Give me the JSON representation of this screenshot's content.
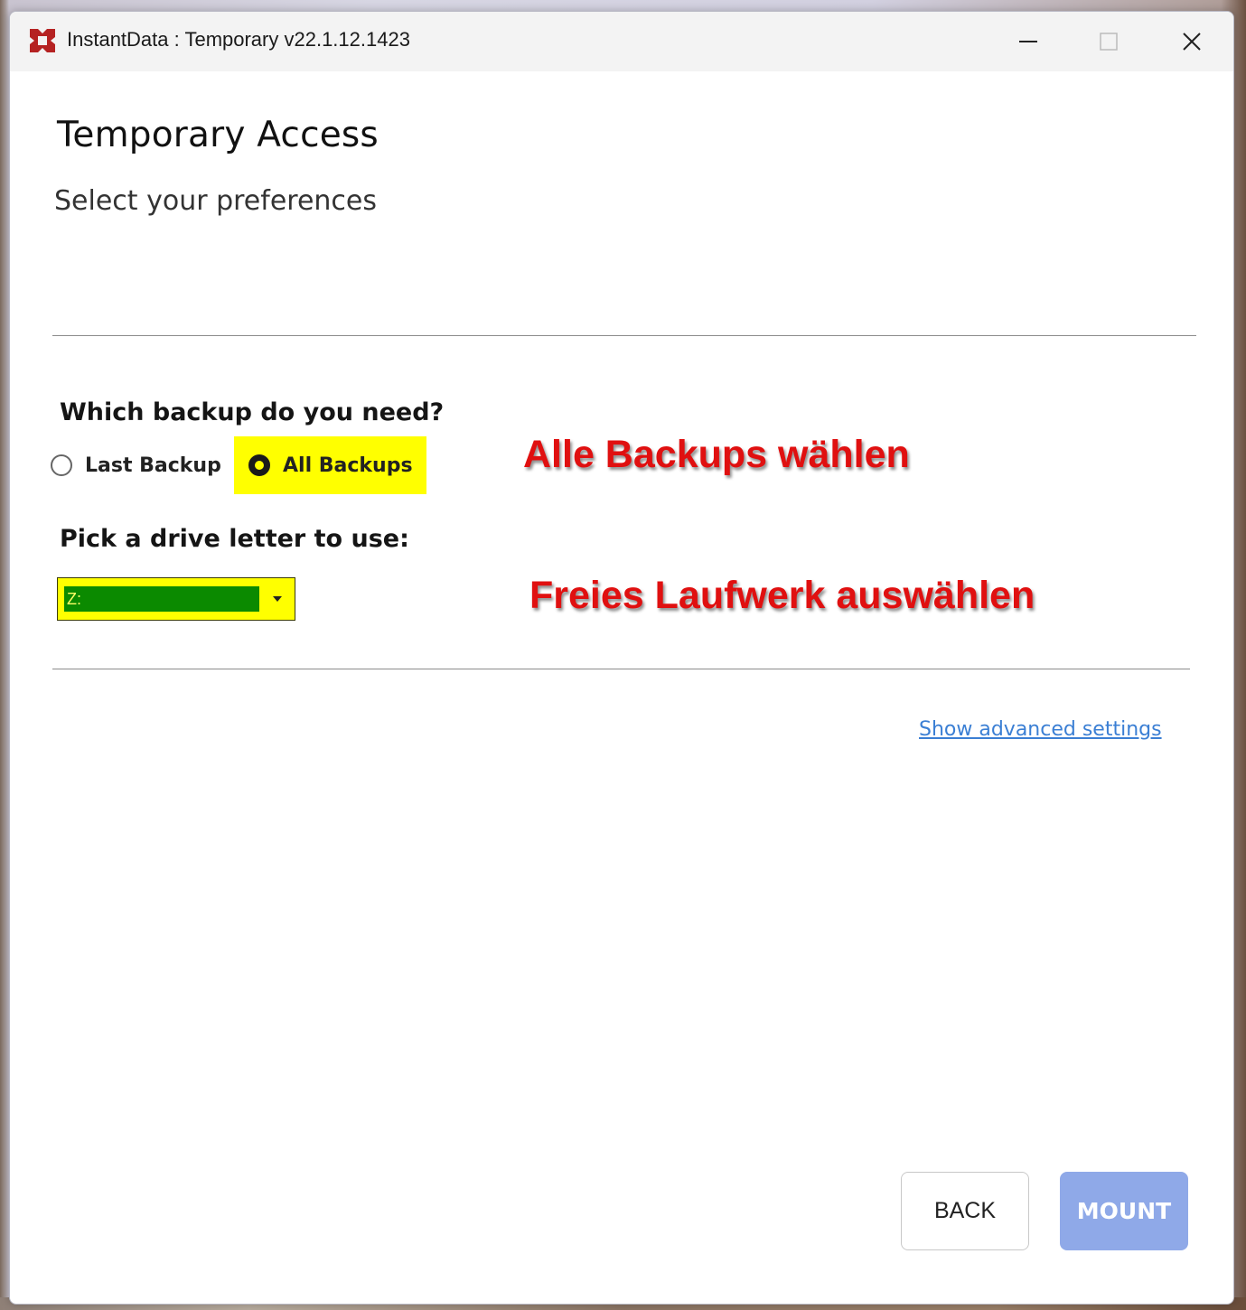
{
  "window": {
    "title": "InstantData : Temporary v22.1.12.1423",
    "app_icon": "instantdata-logo-icon",
    "controls": [
      "minimize-icon",
      "maximize-icon",
      "close-icon"
    ]
  },
  "page": {
    "heading": "Temporary Access",
    "subheading": "Select your preferences"
  },
  "backup": {
    "question": "Which backup do you need?",
    "options": [
      {
        "label": "Last Backup",
        "selected": false
      },
      {
        "label": "All Backups",
        "selected": true
      }
    ]
  },
  "drive": {
    "question": "Pick a drive letter to use:",
    "selected": "Z:"
  },
  "annotations": {
    "backup_hint": "Alle Backups wählen",
    "drive_hint": "Freies Laufwerk auswählen"
  },
  "links": {
    "advanced": "Show advanced settings"
  },
  "buttons": {
    "back": "BACK",
    "mount": "MOUNT"
  },
  "colors": {
    "highlight": "#ffff00",
    "annotation": "#e01010",
    "link": "#3b7fd4",
    "mount_button": "#8fa9e8",
    "drive_fill": "#0b8a00",
    "brand_icon": "#b22222"
  }
}
